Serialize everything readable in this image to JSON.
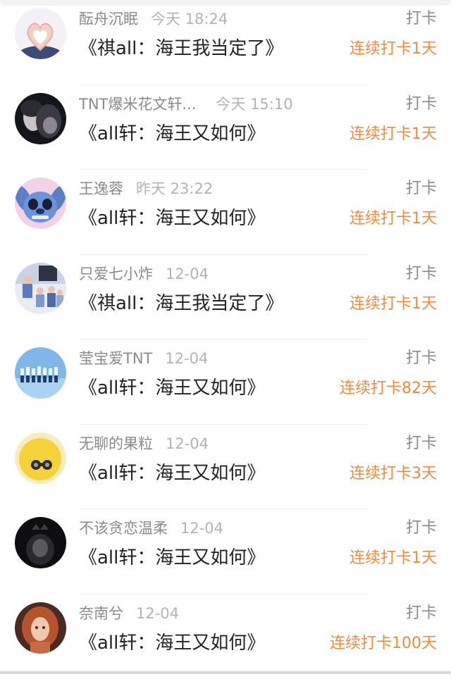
{
  "feed": {
    "items": [
      {
        "name": "酝舟沉眠",
        "time": "今天 18:24",
        "title": "《祺all：海王我当定了》",
        "action": "打卡",
        "streak": "连续打卡1天",
        "avatar_icon": "heart-hands-avatar"
      },
      {
        "name": "TNT爆米花文轩...",
        "time": "今天 15:10",
        "title": "《all轩：海王又如何》",
        "action": "打卡",
        "streak": "连续打卡1天",
        "avatar_icon": "dark-portrait-avatar"
      },
      {
        "name": "王逸蓉",
        "time": "昨天 23:22",
        "title": "《all轩：海王又如何》",
        "action": "打卡",
        "streak": "连续打卡1天",
        "avatar_icon": "stitch-avatar"
      },
      {
        "name": "只爱七小炸",
        "time": "12-04",
        "title": "《祺all：海王我当定了》",
        "action": "打卡",
        "streak": "连续打卡1天",
        "avatar_icon": "group-photo-avatar"
      },
      {
        "name": "莹宝爱TNT",
        "time": "12-04",
        "title": "《all轩：海王又如何》",
        "action": "打卡",
        "streak": "连续打卡82天",
        "avatar_icon": "sky-group-avatar"
      },
      {
        "name": "无聊的果粒",
        "time": "12-04",
        "title": "《all轩：海王又如何》",
        "action": "打卡",
        "streak": "连续打卡3天",
        "avatar_icon": "yellow-chick-avatar"
      },
      {
        "name": "不该贪恋温柔",
        "time": "12-04",
        "title": "《all轩：海王又如何》",
        "action": "打卡",
        "streak": "连续打卡1天",
        "avatar_icon": "dark-crown-avatar"
      },
      {
        "name": "奈南兮",
        "time": "12-04",
        "title": "《all轩：海王又如何》",
        "action": "打卡",
        "streak": "连续打卡100天",
        "avatar_icon": "redhead-girl-avatar"
      }
    ]
  },
  "colors": {
    "streak": "#ee8a42",
    "name": "#8a8a8a",
    "time": "#b3b3b3",
    "title": "#222222"
  }
}
